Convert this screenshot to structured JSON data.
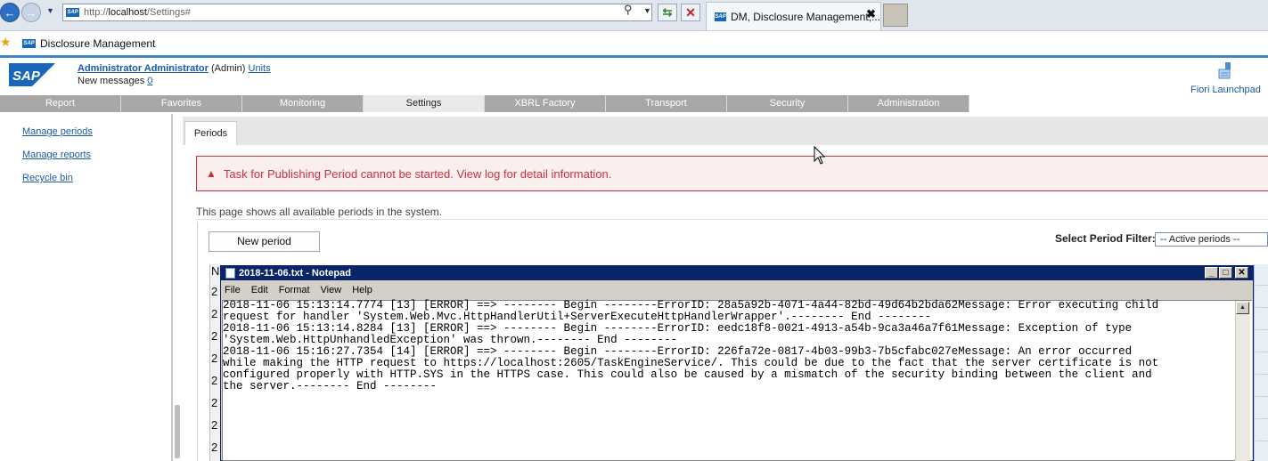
{
  "browser": {
    "url_prefix": "http://",
    "url_host": "localhost",
    "url_path": "/Settings#",
    "tab_title": "DM, Disclosure Management,...",
    "favorites_item": "Disclosure Management"
  },
  "header": {
    "user_name": "Administrator Administrator",
    "role": "(Admin)",
    "units_link": "Units",
    "messages_label": "New messages",
    "messages_count": "0",
    "launchpad_label": "Fiori Launchpad"
  },
  "nav": {
    "tabs": [
      "Report",
      "Favorites",
      "Monitoring",
      "Settings",
      "XBRL Factory",
      "Transport",
      "Security",
      "Administration"
    ],
    "active": "Settings"
  },
  "sidebar": {
    "items": [
      "Manage periods",
      "Manage reports",
      "Recycle bin"
    ]
  },
  "content": {
    "tab_label": "Periods",
    "error_message": "Task for Publishing Period cannot be started. View log for detail information.",
    "intro": "This page shows all available periods in the system.",
    "new_period_button": "New period",
    "filter_label": "Select Period Filter:",
    "filter_value": "-- Active periods --",
    "row_digits": [
      "2",
      "2",
      "2",
      "2",
      "2",
      "2",
      "2",
      "2"
    ],
    "table_header_initial": "N"
  },
  "notepad": {
    "title": "2018-11-06.txt - Notepad",
    "menu": [
      "File",
      "Edit",
      "Format",
      "View",
      "Help"
    ],
    "lines": [
      "2018-11-06 15:13:14.7774 [13] [ERROR] ==> -------- Begin --------ErrorID: 28a5a92b-4071-4a44-82bd-49d64b2bda62Message: Error executing child",
      "request for handler 'System.Web.Mvc.HttpHandlerUtil+ServerExecuteHttpHandlerWrapper'.-------- End --------",
      "2018-11-06 15:13:14.8284 [13] [ERROR] ==> -------- Begin --------ErrorID: eedc18f8-0021-4913-a54b-9ca3a46a7f61Message: Exception of type",
      "'System.Web.HttpUnhandledException' was thrown.-------- End --------",
      "2018-11-06 15:16:27.7354 [14] [ERROR] ==> -------- Begin --------ErrorID: 226fa72e-0817-4b03-99b3-7b5cfabc027eMessage: An error occurred",
      "while making the HTTP request to https://localhost:2605/TaskEngineService/. This could be due to the fact that the server certificate is not",
      "configured properly with HTTP.SYS in the HTTPS case. This could also be caused by a mismatch of the security binding between the client and",
      "the server.-------- End --------"
    ]
  },
  "colors": {
    "sap_blue": "#1767b9",
    "error_red": "#c8333f",
    "nav_gray": "#a7a7a7",
    "notepad_title": "#0a246a"
  }
}
